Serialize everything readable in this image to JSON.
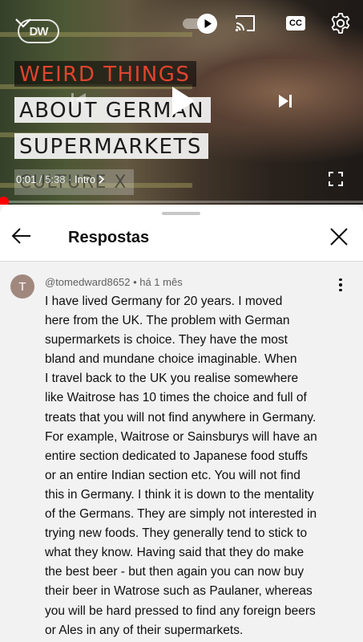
{
  "player": {
    "logo_text": "DW",
    "title_lines": [
      "WEIRD THINGS",
      "ABOUT GERMAN",
      "SUPERMARKETS",
      "CULTURE X"
    ],
    "current_time": "0:01",
    "duration": "5:38",
    "chapter": "Intro",
    "cc_label": "CC",
    "progress_percent": 0.3,
    "accent_color": "#ff0000",
    "icons": {
      "collapse": "chevron-down-icon",
      "autoplay": "autoplay-toggle-icon",
      "cast": "cast-icon",
      "captions": "cc-icon",
      "settings": "gear-icon",
      "previous": "skip-previous-icon",
      "play": "play-icon",
      "next": "skip-next-icon",
      "fullscreen": "fullscreen-icon"
    }
  },
  "replies": {
    "title": "Respostas",
    "icons": {
      "back": "arrow-left-icon",
      "close": "close-icon",
      "more": "more-vertical-icon"
    },
    "comment": {
      "avatar_letter": "T",
      "author": "@tomedward8652",
      "age": "há 1 mês",
      "lines": [
        "I have lived Germany for 20 years. I moved",
        "here from the UK. The problem with German",
        "supermarkets is choice. They have the most",
        "bland and mundane choice imaginable. When",
        "I travel back to the UK you realise somewhere",
        "like Waitrose has 10 times the choice and full of",
        "treats that you will not find anywhere in Germany.",
        "For example, Waitrose or Sainsburys will have an",
        "entire section dedicated to Japanese food stuffs",
        "or an entire Indian section etc. You will not find",
        "this in Germany. I think it is down to the mentality",
        "of the Germans. They are simply not interested in",
        "trying new foods. They generally tend to stick to",
        "what they know. Having said that they do make",
        "the best beer - but then again you can now buy",
        "their beer in Watrose such as Paulaner, whereas",
        "you will be hard pressed to find any foreign beers",
        "or Ales in any of their supermarkets."
      ]
    }
  }
}
